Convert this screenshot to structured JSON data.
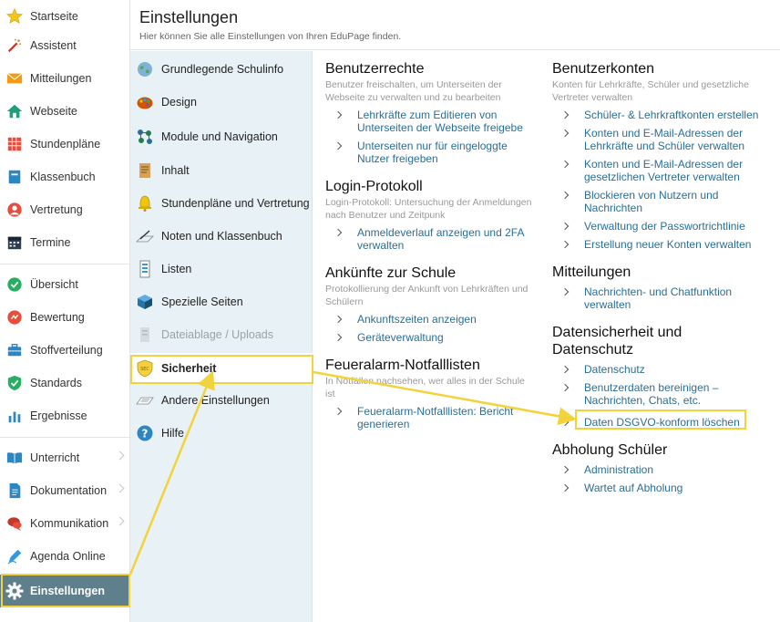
{
  "sidebar": {
    "items": [
      {
        "label": "Startseite",
        "icon": "star-icon"
      },
      {
        "label": "Assistent",
        "icon": "wand-icon"
      },
      {
        "label": "Mitteilungen",
        "icon": "envelope-icon"
      },
      {
        "label": "Webseite",
        "icon": "home-icon"
      },
      {
        "label": "Stundenpläne",
        "icon": "timetable-icon"
      },
      {
        "label": "Klassenbuch",
        "icon": "book-icon"
      },
      {
        "label": "Vertretung",
        "icon": "substitute-icon"
      },
      {
        "label": "Termine",
        "icon": "calendar-icon"
      },
      {
        "label": "Übersicht",
        "icon": "check-icon"
      },
      {
        "label": "Bewertung",
        "icon": "rating-icon"
      },
      {
        "label": "Stoffverteilung",
        "icon": "briefcase-icon"
      },
      {
        "label": "Standards",
        "icon": "shield-check-icon"
      },
      {
        "label": "Ergebnisse",
        "icon": "bar-chart-icon"
      },
      {
        "label": "Unterricht",
        "icon": "open-book-icon"
      },
      {
        "label": "Dokumentation",
        "icon": "document-icon"
      },
      {
        "label": "Kommunikation",
        "icon": "chat-icon"
      },
      {
        "label": "Agenda Online",
        "icon": "pen-icon"
      },
      {
        "label": "Einstellungen",
        "icon": "gear-icon"
      }
    ]
  },
  "header": {
    "title": "Einstellungen",
    "subtitle": "Hier können Sie alle Einstellungen von Ihren EduPage finden."
  },
  "menu": {
    "items": [
      {
        "label": "Grundlegende Schulinfo"
      },
      {
        "label": "Design"
      },
      {
        "label": "Module und Navigation"
      },
      {
        "label": "Inhalt"
      },
      {
        "label": "Stundenpläne und Vertretung"
      },
      {
        "label": "Noten und Klassenbuch"
      },
      {
        "label": "Listen"
      },
      {
        "label": "Spezielle Seiten"
      },
      {
        "label": "Dateiablage / Uploads"
      },
      {
        "label": "Sicherheit"
      },
      {
        "label": "Andere Einstellungen"
      },
      {
        "label": "Hilfe"
      }
    ]
  },
  "left_col": {
    "benutzerrechte": {
      "title": "Benutzerrechte",
      "desc": "Benutzer freischalten, um Unterseiten der Webseite zu verwalten und zu bearbeiten",
      "links": [
        "Lehrkräfte zum Editieren von Unterseiten der Webseite freigebe",
        "Unterseiten nur für eingeloggte Nutzer freigeben"
      ]
    },
    "login": {
      "title": "Login-Protokoll",
      "desc": "Login-Protokoll: Untersuchung der Anmeldungen nach Benutzer und Zeitpunk",
      "links": [
        "Anmeldeverlauf anzeigen und 2FA verwalten"
      ]
    },
    "ankuenfte": {
      "title": "Ankünfte zur Schule",
      "desc": "Protokollierung der Ankunft von Lehrkräften und Schülern",
      "links": [
        "Ankunftszeiten anzeigen",
        "Geräteverwaltung"
      ]
    },
    "feueralarm": {
      "title": "Feueralarm-Notfalllisten",
      "desc": "In Notfällen nachsehen, wer alles in der Schule ist",
      "links": [
        "Feueralarm-Notfalllisten: Bericht generieren"
      ]
    }
  },
  "right_col": {
    "konten": {
      "title": "Benutzerkonten",
      "desc": "Konten für Lehrkräfte, Schüler und gesetzliche Vertreter verwalten",
      "links": [
        "Schüler- & Lehrkraftkonten erstellen",
        "Konten und E-Mail-Adressen der Lehrkräfte und Schüler verwalten",
        "Konten und E-Mail-Adressen der gesetzlichen Vertreter verwalten",
        "Blockieren von Nutzern und Nachrichten",
        "Verwaltung der Passwortrichtlinie",
        "Erstellung neuer Konten verwalten"
      ]
    },
    "mitteilungen": {
      "title": "Mitteilungen",
      "links": [
        "Nachrichten- und Chatfunktion verwalten"
      ]
    },
    "datensicherheit": {
      "title": "Datensicherheit und Datenschutz",
      "links": [
        "Datenschutz",
        "Benutzerdaten bereinigen – Nachrichten, Chats, etc.",
        "Daten DSGVO-konform löschen"
      ]
    },
    "abholung": {
      "title": "Abholung Schüler",
      "links": [
        "Administration",
        "Wartet auf Abholung"
      ]
    }
  },
  "colors": {
    "highlight": "#f2d33c",
    "active_sidebar": "#5f7f8c",
    "link": "#2a6e96",
    "menu_bg": "#e8f1f6"
  }
}
